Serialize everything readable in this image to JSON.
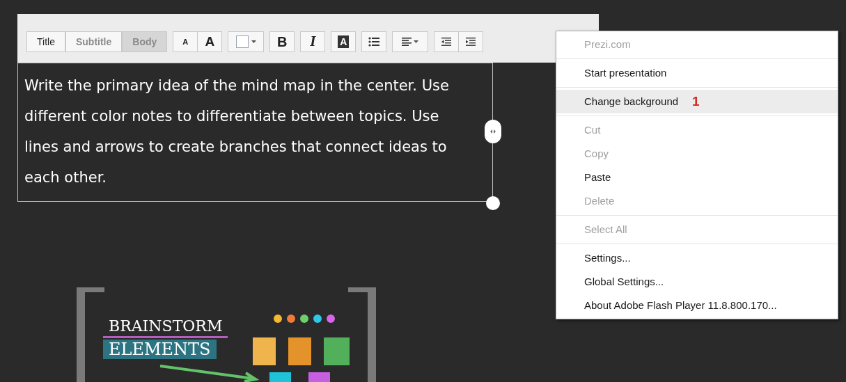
{
  "toolbar": {
    "styles": [
      {
        "label": "Title",
        "selected": false,
        "disabled": false
      },
      {
        "label": "Subtitle",
        "selected": false,
        "disabled": true
      },
      {
        "label": "Body",
        "selected": true,
        "disabled": true
      }
    ],
    "buttons": [
      {
        "kind": "small",
        "label": "A"
      },
      {
        "kind": "large",
        "label": "A"
      },
      {
        "kind": "color"
      },
      {
        "kind": "bold",
        "label": "B"
      },
      {
        "kind": "italic",
        "label": "I"
      },
      {
        "kind": "highlight",
        "label": "A"
      },
      {
        "kind": "bullets"
      },
      {
        "kind": "align"
      },
      {
        "kind": "outdent"
      },
      {
        "kind": "indent"
      }
    ]
  },
  "text_box": {
    "text": "Write the primary idea of the mind map in the center. Use different color notes to differentiate between topics. Use lines and arrows to create branches that connect ideas to each other."
  },
  "artwork": {
    "title_top": "BRAINSTORM",
    "title_bottom": "ELEMENTS"
  },
  "context_menu": [
    {
      "kind": "item",
      "label": "Prezi.com",
      "disabled": true,
      "selected": false
    },
    {
      "kind": "separator"
    },
    {
      "kind": "item",
      "label": "Start presentation",
      "disabled": false,
      "selected": false
    },
    {
      "kind": "separator"
    },
    {
      "kind": "item",
      "label": "Change background",
      "disabled": false,
      "selected": true,
      "marker": "1"
    },
    {
      "kind": "separator"
    },
    {
      "kind": "item",
      "label": "Cut",
      "disabled": true,
      "selected": false
    },
    {
      "kind": "item",
      "label": "Copy",
      "disabled": true,
      "selected": false
    },
    {
      "kind": "item",
      "label": "Paste",
      "disabled": false,
      "selected": false
    },
    {
      "kind": "item",
      "label": "Delete",
      "disabled": true,
      "selected": false
    },
    {
      "kind": "separator"
    },
    {
      "kind": "item",
      "label": "Select All",
      "disabled": true,
      "selected": false
    },
    {
      "kind": "separator"
    },
    {
      "kind": "item",
      "label": "Settings...",
      "disabled": false,
      "selected": false
    },
    {
      "kind": "item",
      "label": "Global Settings...",
      "disabled": false,
      "selected": false
    },
    {
      "kind": "item",
      "label": "About Adobe Flash Player 11.8.800.170...",
      "disabled": false,
      "selected": false
    }
  ]
}
